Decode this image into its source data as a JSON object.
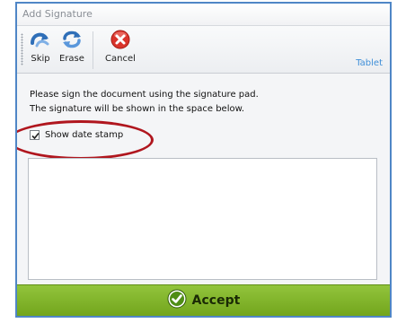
{
  "window": {
    "title": "Add Signature"
  },
  "toolbar": {
    "skip_label": "Skip",
    "erase_label": "Erase",
    "cancel_label": "Cancel",
    "tablet_label": "Tablet"
  },
  "instructions": {
    "line1": "Please sign the document using the signature pad.",
    "line2": "The signature will be shown in the space below."
  },
  "date_stamp": {
    "label": "Show date stamp",
    "checked": true
  },
  "accept": {
    "label": "Accept"
  },
  "colors": {
    "accent_border": "#4f86c6",
    "accept_bar": "#82b62a",
    "highlight_ring": "#b0161e",
    "tablet_link": "#3f8fd8"
  },
  "icons": [
    "skip-icon",
    "erase-icon",
    "cancel-icon",
    "checkmark-icon"
  ]
}
